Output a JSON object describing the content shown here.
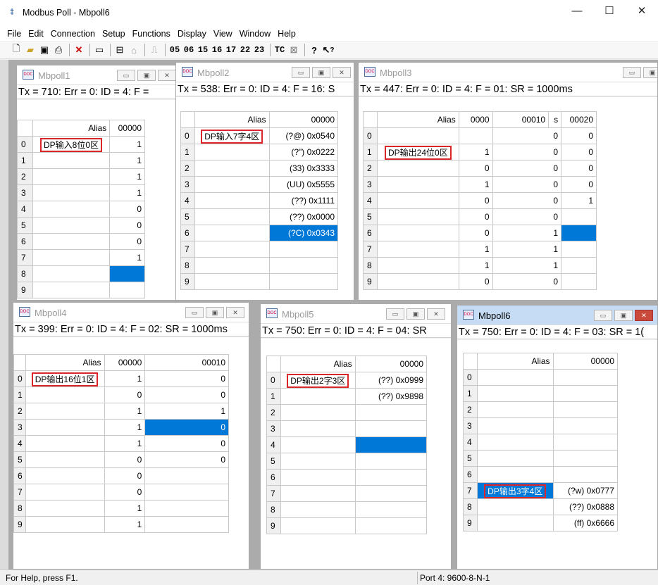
{
  "app": {
    "icon": "modbus-icon",
    "title": "Modbus Poll - Mbpoll6"
  },
  "window_controls": {
    "minimize": "—",
    "maximize": "☐",
    "close": "✕"
  },
  "menu": [
    "File",
    "Edit",
    "Connection",
    "Setup",
    "Functions",
    "Display",
    "View",
    "Window",
    "Help"
  ],
  "toolbar": {
    "buttons": [
      "new-icon",
      "open-icon",
      "save-icon",
      "print-icon",
      "delete-icon",
      "window-icon",
      "connect-icon",
      "disconnect-icon",
      "pulse-icon"
    ],
    "codes": [
      "05",
      "06",
      "15",
      "16",
      "17",
      "22",
      "23",
      "TC"
    ],
    "help": "?",
    "context_help": "?"
  },
  "colors": {
    "selection": "#0078d7",
    "highlight": "#d9262a",
    "mdi_background": "#ababab"
  },
  "windows": [
    {
      "name": "Mbpoll1",
      "info": "Tx = 710: Err = 0: ID = 4: F =",
      "headers": [
        "",
        "Alias",
        "00000"
      ],
      "rows": [
        [
          "0",
          "DP输入8位0区",
          "1"
        ],
        [
          "1",
          "",
          "1"
        ],
        [
          "2",
          "",
          "1"
        ],
        [
          "3",
          "",
          "1"
        ],
        [
          "4",
          "",
          "0"
        ],
        [
          "5",
          "",
          "0"
        ],
        [
          "6",
          "",
          "0"
        ],
        [
          "7",
          "",
          "1"
        ],
        [
          "8",
          "",
          ""
        ],
        [
          "9",
          "",
          ""
        ]
      ]
    },
    {
      "name": "Mbpoll2",
      "info": "Tx = 538: Err = 0: ID = 4: F = 16: S",
      "headers": [
        "",
        "Alias",
        "00000"
      ],
      "rows": [
        [
          "0",
          "DP输入7字4区",
          "(?@) 0x0540"
        ],
        [
          "1",
          "",
          "(?\") 0x0222"
        ],
        [
          "2",
          "",
          "(33) 0x3333"
        ],
        [
          "3",
          "",
          "(UU) 0x5555"
        ],
        [
          "4",
          "",
          "(??) 0x1111"
        ],
        [
          "5",
          "",
          "(??) 0x0000"
        ],
        [
          "6",
          "",
          "(?C) 0x0343"
        ],
        [
          "7",
          "",
          ""
        ],
        [
          "8",
          "",
          ""
        ],
        [
          "9",
          "",
          ""
        ]
      ]
    },
    {
      "name": "Mbpoll3",
      "info": "Tx = 447: Err = 0: ID = 4: F = 01: SR = 1000ms",
      "headers": [
        "",
        "Alias",
        "0000",
        "00010",
        "s",
        "00020"
      ],
      "rows": [
        [
          "0",
          "",
          "",
          "0",
          "",
          "0"
        ],
        [
          "1",
          "DP输出24位0区",
          "1",
          "0",
          "",
          "0"
        ],
        [
          "2",
          "",
          "0",
          "0",
          "",
          "0"
        ],
        [
          "3",
          "",
          "1",
          "0",
          "",
          "0"
        ],
        [
          "4",
          "",
          "0",
          "0",
          "",
          "1"
        ],
        [
          "5",
          "",
          "0",
          "0",
          "",
          ""
        ],
        [
          "6",
          "",
          "0",
          "1",
          "",
          ""
        ],
        [
          "7",
          "",
          "1",
          "1",
          "",
          ""
        ],
        [
          "8",
          "",
          "1",
          "1",
          "",
          ""
        ],
        [
          "9",
          "",
          "0",
          "0",
          "",
          ""
        ]
      ]
    },
    {
      "name": "Mbpoll4",
      "info": "Tx = 399: Err = 0: ID = 4: F = 02: SR = 1000ms",
      "headers": [
        "",
        "Alias",
        "00000",
        "00010"
      ],
      "rows": [
        [
          "0",
          "DP输出16位1区",
          "1",
          "0"
        ],
        [
          "1",
          "",
          "0",
          "0"
        ],
        [
          "2",
          "",
          "1",
          "1"
        ],
        [
          "3",
          "",
          "1",
          "0"
        ],
        [
          "4",
          "",
          "1",
          "0"
        ],
        [
          "5",
          "",
          "0",
          "0"
        ],
        [
          "6",
          "",
          "0",
          ""
        ],
        [
          "7",
          "",
          "0",
          ""
        ],
        [
          "8",
          "",
          "1",
          ""
        ],
        [
          "9",
          "",
          "1",
          ""
        ]
      ]
    },
    {
      "name": "Mbpoll5",
      "info": "Tx = 750: Err = 0: ID = 4: F = 04: SR",
      "headers": [
        "",
        "Alias",
        "00000"
      ],
      "rows": [
        [
          "0",
          "DP输出2字3区",
          "(??) 0x0999"
        ],
        [
          "1",
          "",
          "(??) 0x9898"
        ],
        [
          "2",
          "",
          ""
        ],
        [
          "3",
          "",
          ""
        ],
        [
          "4",
          "",
          ""
        ],
        [
          "5",
          "",
          ""
        ],
        [
          "6",
          "",
          ""
        ],
        [
          "7",
          "",
          ""
        ],
        [
          "8",
          "",
          ""
        ],
        [
          "9",
          "",
          ""
        ]
      ]
    },
    {
      "name": "Mbpoll6",
      "info": "Tx = 750: Err = 0: ID = 4: F = 03: SR = 1(",
      "headers": [
        "",
        "Alias",
        "00000"
      ],
      "rows": [
        [
          "0",
          "",
          ""
        ],
        [
          "1",
          "",
          ""
        ],
        [
          "2",
          "",
          ""
        ],
        [
          "3",
          "",
          ""
        ],
        [
          "4",
          "",
          ""
        ],
        [
          "5",
          "",
          ""
        ],
        [
          "6",
          "",
          ""
        ],
        [
          "7",
          "DP输出3字4区",
          "(?w) 0x0777"
        ],
        [
          "8",
          "",
          "(??) 0x0888"
        ],
        [
          "9",
          "",
          "(ff) 0x6666"
        ]
      ]
    }
  ],
  "status": {
    "help": "For Help, press F1.",
    "port": "Port 4: 9600-8-N-1"
  }
}
